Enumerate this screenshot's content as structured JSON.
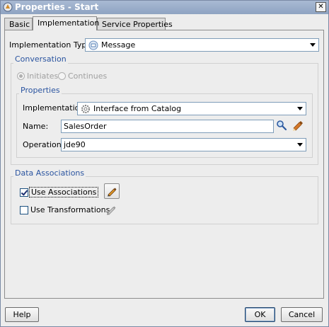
{
  "window": {
    "title": "Properties - Start"
  },
  "tabs": [
    {
      "label": "Basic",
      "active": false
    },
    {
      "label": "Implementation",
      "active": true
    },
    {
      "label": "Service Properties",
      "active": false
    }
  ],
  "implementation_type": {
    "label": "Implementation Type:",
    "value": "Message",
    "icon": "message-icon"
  },
  "conversation": {
    "title": "Conversation",
    "radios": [
      {
        "label": "Initiates",
        "selected": true,
        "enabled": false
      },
      {
        "label": "Continues",
        "selected": false,
        "enabled": false
      }
    ],
    "properties": {
      "title": "Properties",
      "implementation": {
        "label": "Implementation:",
        "value": "Interface from Catalog",
        "icon": "gear-icon"
      },
      "name": {
        "label": "Name:",
        "value": "SalesOrder"
      },
      "operation": {
        "label": "Operation:",
        "value": "jde90"
      }
    }
  },
  "data_associations": {
    "title": "Data Associations",
    "use_associations": {
      "label": "Use Associations",
      "checked": true
    },
    "use_transformations": {
      "label": "Use Transformations",
      "checked": false
    }
  },
  "buttons": {
    "help": "Help",
    "ok": "OK",
    "cancel": "Cancel"
  },
  "colors": {
    "accent": "#2a54a0",
    "titlebar": "#8ea3c2",
    "background": "#ededed"
  }
}
